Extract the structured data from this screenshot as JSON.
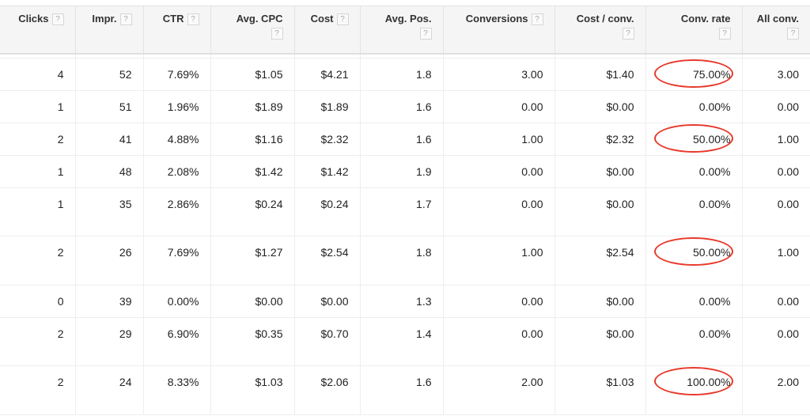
{
  "table": {
    "columns": [
      {
        "label": "Clicks",
        "help": "?"
      },
      {
        "label": "Impr.",
        "help": "?"
      },
      {
        "label": "CTR",
        "help": "?"
      },
      {
        "label": "Avg. CPC",
        "help": "?"
      },
      {
        "label": "Cost",
        "help": "?"
      },
      {
        "label": "Avg. Pos.",
        "help": "?"
      },
      {
        "label": "Conversions",
        "help": "?"
      },
      {
        "label": "Cost / conv.",
        "help": "?"
      },
      {
        "label": "Conv. rate",
        "help": "?"
      },
      {
        "label": "All conv.",
        "help": "?"
      }
    ],
    "rows": [
      {
        "cells": [
          "4",
          "52",
          "7.69%",
          "$1.05",
          "$4.21",
          "1.8",
          "3.00",
          "$1.40",
          "75.00%",
          "3.00"
        ],
        "highlighted": true
      },
      {
        "cells": [
          "1",
          "51",
          "1.96%",
          "$1.89",
          "$1.89",
          "1.6",
          "0.00",
          "$0.00",
          "0.00%",
          "0.00"
        ],
        "highlighted": false
      },
      {
        "cells": [
          "2",
          "41",
          "4.88%",
          "$1.16",
          "$2.32",
          "1.6",
          "1.00",
          "$2.32",
          "50.00%",
          "1.00"
        ],
        "highlighted": true
      },
      {
        "cells": [
          "1",
          "48",
          "2.08%",
          "$1.42",
          "$1.42",
          "1.9",
          "0.00",
          "$0.00",
          "0.00%",
          "0.00"
        ],
        "highlighted": false
      },
      {
        "cells": [
          "1",
          "35",
          "2.86%",
          "$0.24",
          "$0.24",
          "1.7",
          "0.00",
          "$0.00",
          "0.00%",
          "0.00"
        ],
        "highlighted": false
      },
      {
        "cells": [
          "2",
          "26",
          "7.69%",
          "$1.27",
          "$2.54",
          "1.8",
          "1.00",
          "$2.54",
          "50.00%",
          "1.00"
        ],
        "highlighted": true
      },
      {
        "cells": [
          "0",
          "39",
          "0.00%",
          "$0.00",
          "$0.00",
          "1.3",
          "0.00",
          "$0.00",
          "0.00%",
          "0.00"
        ],
        "highlighted": false
      },
      {
        "cells": [
          "2",
          "29",
          "6.90%",
          "$0.35",
          "$0.70",
          "1.4",
          "0.00",
          "$0.00",
          "0.00%",
          "0.00"
        ],
        "highlighted": false
      },
      {
        "cells": [
          "2",
          "24",
          "8.33%",
          "$1.03",
          "$2.06",
          "1.6",
          "2.00",
          "$1.03",
          "100.00%",
          "2.00"
        ],
        "highlighted": true
      }
    ]
  },
  "colors": {
    "highlight_ring": "#e8392b",
    "header_bg": "#f5f5f5"
  }
}
